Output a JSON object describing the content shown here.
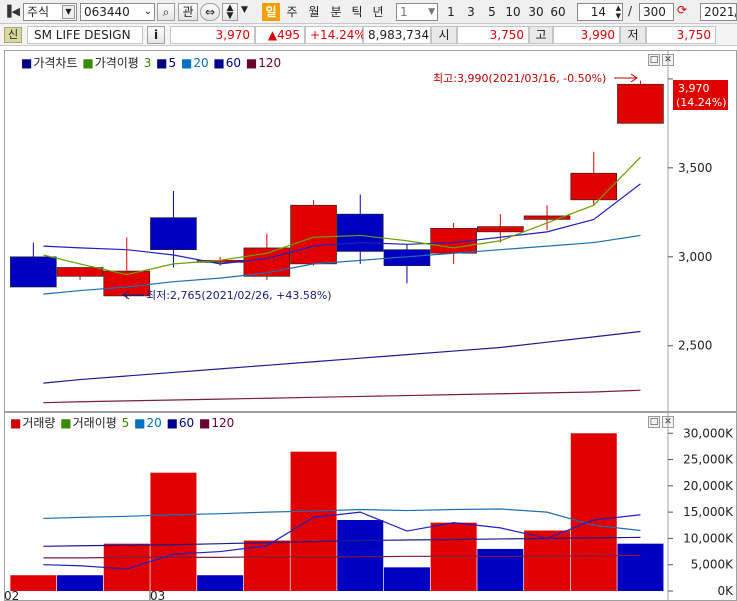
{
  "toolbar": {
    "market": "주식",
    "code": "063440",
    "btn_gwan": "관",
    "period_active": "일",
    "periods": [
      "주",
      "월",
      "분",
      "틱",
      "년"
    ],
    "interval_value": "1",
    "intervals": [
      "1",
      "3",
      "5",
      "10",
      "30",
      "60"
    ],
    "count_value": "14",
    "slash": "/",
    "total_value": "300",
    "date_value": "2021/"
  },
  "quote": {
    "badge": "신",
    "name": "SM LIFE DESIGN",
    "info_btn": "i",
    "price": "3,970",
    "change": "▲495",
    "change_pct": "+14.24%",
    "volume": "8,983,734",
    "open_label": "시",
    "open_value": "3,750",
    "high_label": "고",
    "high_value": "3,990",
    "low_label": "저",
    "low_value": "3,750"
  },
  "price_panel": {
    "legend": [
      {
        "text": "가격차트",
        "color": "#000080"
      },
      {
        "text": "가격이평",
        "color": "#3a8a00"
      },
      {
        "text": "3",
        "color": "#3a8a00"
      },
      {
        "text": "5",
        "color": "#000080"
      },
      {
        "text": "20",
        "color": "#0070c0"
      },
      {
        "text": "60",
        "color": "#00008b"
      },
      {
        "text": "120",
        "color": "#6b0030"
      }
    ],
    "high_annotation": "최고:3,990(2021/03/16, -0.50%)",
    "low_annotation": "최저:2,765(2021/02/26, +43.58%)",
    "current_price_label": "3,970",
    "current_pct_label": "(14.24%)"
  },
  "volume_panel": {
    "legend": [
      {
        "text": "거래량",
        "color": "#d00000"
      },
      {
        "text": "거래이평",
        "color": "#3a8a00"
      },
      {
        "text": "5",
        "color": "#3a8a00"
      },
      {
        "text": "20",
        "color": "#0070c0"
      },
      {
        "text": "60",
        "color": "#00008b"
      },
      {
        "text": "120",
        "color": "#6b0030"
      }
    ],
    "x_labels": [
      "02",
      "03"
    ]
  },
  "colors": {
    "up": "#e00000",
    "down": "#0000c0",
    "ma3": "#6aa000",
    "ma5": "#2020c0",
    "ma20": "#1f6fb0",
    "ma60": "#1c1c8c",
    "ma120": "#7a1f3d"
  },
  "chart_data": [
    {
      "type": "candlestick",
      "title": "가격차트",
      "ylim": [
        2150,
        4050
      ],
      "yticks": [
        2500,
        3000,
        3500
      ],
      "ytick_labels": [
        "2,500",
        "3,000",
        "3,500"
      ],
      "candles": [
        {
          "o": 3000,
          "h": 3080,
          "l": 2830,
          "c": 2830,
          "up": false
        },
        {
          "o": 2890,
          "h": 2940,
          "l": 2870,
          "c": 2940,
          "up": true
        },
        {
          "o": 2780,
          "h": 3110,
          "l": 2765,
          "c": 2920,
          "up": true
        },
        {
          "o": 3220,
          "h": 3370,
          "l": 2940,
          "c": 3040,
          "up": false
        },
        {
          "o": 2970,
          "h": 3000,
          "l": 2950,
          "c": 2980,
          "up": true
        },
        {
          "o": 2890,
          "h": 3130,
          "l": 2870,
          "c": 3050,
          "up": true
        },
        {
          "o": 2960,
          "h": 3320,
          "l": 2950,
          "c": 3290,
          "up": true
        },
        {
          "o": 3240,
          "h": 3350,
          "l": 2960,
          "c": 3030,
          "up": false
        },
        {
          "o": 3040,
          "h": 3070,
          "l": 2850,
          "c": 2950,
          "up": false
        },
        {
          "o": 3020,
          "h": 3190,
          "l": 2960,
          "c": 3160,
          "up": true
        },
        {
          "o": 3140,
          "h": 3240,
          "l": 3080,
          "c": 3170,
          "up": true
        },
        {
          "o": 3210,
          "h": 3290,
          "l": 3150,
          "c": 3230,
          "up": true
        },
        {
          "o": 3320,
          "h": 3590,
          "l": 3290,
          "c": 3470,
          "up": true
        },
        {
          "o": 3750,
          "h": 3990,
          "l": 3750,
          "c": 3970,
          "up": true
        }
      ],
      "ma3": [
        3010,
        2960,
        2900,
        2960,
        2980,
        3020,
        3110,
        3120,
        3090,
        3050,
        3090,
        3190,
        3290,
        3560
      ],
      "ma5": [
        3060,
        3050,
        3040,
        3010,
        2960,
        2990,
        3060,
        3080,
        3070,
        3080,
        3110,
        3140,
        3210,
        3410
      ],
      "ma20": [
        2790,
        2810,
        2830,
        2860,
        2880,
        2910,
        2960,
        2980,
        3000,
        3020,
        3040,
        3060,
        3080,
        3120
      ],
      "ma60": [
        2290,
        2310,
        2330,
        2350,
        2370,
        2390,
        2410,
        2430,
        2450,
        2470,
        2490,
        2520,
        2550,
        2580
      ],
      "ma120": [
        2180,
        2185,
        2190,
        2195,
        2200,
        2205,
        2210,
        2215,
        2220,
        2225,
        2230,
        2235,
        2240,
        2250
      ]
    },
    {
      "type": "bar",
      "title": "거래량",
      "ylim": [
        0,
        31000
      ],
      "yticks": [
        0,
        5000,
        10000,
        15000,
        20000,
        25000,
        30000
      ],
      "ytick_labels": [
        "0K",
        "5,000K",
        "10,000K",
        "15,000K",
        "20,000K",
        "25,000K",
        "30,000K"
      ],
      "volumes": [
        3000,
        3000,
        9000,
        22500,
        3000,
        9600,
        26500,
        13500,
        4500,
        13000,
        8000,
        11500,
        30000,
        9000
      ],
      "up": [
        true,
        false,
        true,
        true,
        false,
        true,
        true,
        false,
        false,
        true,
        false,
        true,
        true,
        false
      ],
      "ma5": [
        5000,
        4800,
        4200,
        7000,
        7500,
        8600,
        14000,
        15000,
        11400,
        13000,
        12000,
        10000,
        13500,
        14500
      ],
      "ma20": [
        13800,
        14000,
        14200,
        14500,
        14700,
        15000,
        15200,
        15500,
        15300,
        15500,
        15600,
        15000,
        12500,
        11500
      ],
      "ma60": [
        8500,
        8600,
        8700,
        8800,
        9000,
        9200,
        9400,
        9600,
        9700,
        9800,
        9900,
        10000,
        10100,
        10200
      ],
      "ma120": [
        6300,
        6300,
        6400,
        6400,
        6400,
        6500,
        6500,
        6500,
        6600,
        6600,
        6600,
        6600,
        6700,
        6800
      ]
    }
  ]
}
